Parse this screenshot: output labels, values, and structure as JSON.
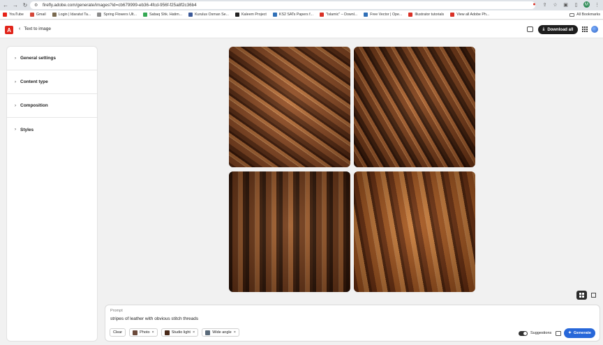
{
  "browser": {
    "url": "firefly.adobe.com/generate/images?id=cb679999-eb36-4fcd-956f-f25a8f2c36b4",
    "profile_initial": "M",
    "bookmarks": [
      {
        "label": "YouTube",
        "color": "#e62117"
      },
      {
        "label": "Gmail",
        "color": "#d44638"
      },
      {
        "label": "Login | Idaratut Ta...",
        "color": "#7a6a4f"
      },
      {
        "label": "Spring Flowers Ult...",
        "color": "#8a8a8a"
      },
      {
        "label": "Sabaq Shk. Hatim...",
        "color": "#34a853"
      },
      {
        "label": "Kurulus Osman Se...",
        "color": "#3b5998"
      },
      {
        "label": "Kaleem Project",
        "color": "#222222"
      },
      {
        "label": "KS2 SATs Papers f...",
        "color": "#2f6fb7"
      },
      {
        "label": "\"Islamic\" – Downl...",
        "color": "#d93025"
      },
      {
        "label": "Free Vector | Ope...",
        "color": "#2f6fb7"
      },
      {
        "label": "Illustrator tutorials",
        "color": "#d93025"
      },
      {
        "label": "View all Adobe Ph...",
        "color": "#d93025"
      }
    ],
    "all_bookmarks_label": "All Bookmarks"
  },
  "header": {
    "back_label": "Text to image",
    "download_all_label": "Download all"
  },
  "sidebar": {
    "sections": [
      {
        "label": "General settings"
      },
      {
        "label": "Content type"
      },
      {
        "label": "Composition"
      },
      {
        "label": "Styles"
      }
    ]
  },
  "prompt": {
    "label": "Prompt",
    "text": "stripes of leather with obvious stitch threads",
    "clear_label": "Clear",
    "chips": [
      {
        "label": "Photo",
        "thumb_color": "#6b4a3a"
      },
      {
        "label": "Studio light",
        "thumb_color": "#4a2a1a"
      },
      {
        "label": "Wide angle",
        "thumb_color": "#5a6a7a"
      }
    ],
    "suggestions_label": "Suggestions",
    "suggestions_on": true,
    "generate_label": "Generate"
  }
}
